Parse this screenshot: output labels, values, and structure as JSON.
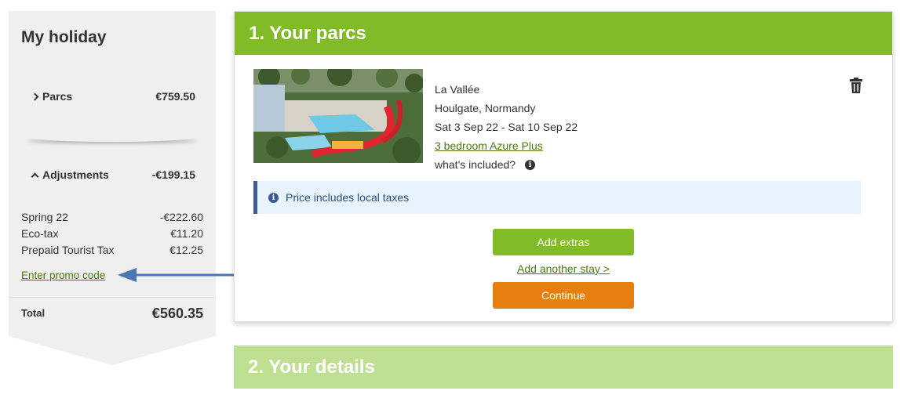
{
  "sidebar": {
    "title": "My holiday",
    "parcs": {
      "label": "Parcs",
      "amount": "€759.50"
    },
    "adjustments": {
      "label": "Adjustments",
      "amount": "-€199.15",
      "lines": [
        {
          "label": "Spring 22",
          "amount": "-€222.60"
        },
        {
          "label": "Eco-tax",
          "amount": "€11.20"
        },
        {
          "label": "Prepaid Tourist Tax",
          "amount": "€12.25"
        }
      ]
    },
    "promo_link": "Enter promo code",
    "total": {
      "label": "Total",
      "amount": "€560.35"
    }
  },
  "step1": {
    "title": "1. Your parcs",
    "parc": {
      "name": "La Vallée",
      "location": "Houlgate, Normandy",
      "dates": "Sat 3 Sep 22 - Sat 10 Sep 22",
      "accommodation_link": "3 bedroom Azure Plus",
      "included": "what's included?"
    },
    "notice": "Price includes local taxes",
    "add_extras": "Add extras",
    "add_another": "Add another stay >",
    "continue": "Continue"
  },
  "step2": {
    "title": "2. Your details"
  },
  "colors": {
    "green": "#82bb28",
    "light_green": "#bfdf92",
    "orange": "#e67e10",
    "link_green": "#4a7a10",
    "notice_bg": "#e7f3fd",
    "notice_border": "#3c5a99",
    "arrow": "#4a76b2"
  },
  "icons": [
    "chevron-right-icon",
    "chevron-up-icon",
    "trash-icon",
    "info-icon",
    "arrow-left-icon"
  ]
}
